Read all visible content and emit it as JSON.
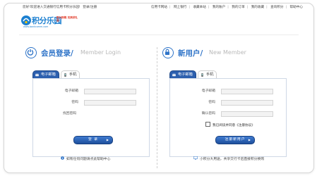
{
  "topbar": {
    "welcome": "您好!欢迎进入交通银行信用卡积分乐园!",
    "login": "登录",
    "register": "注册",
    "links": [
      "信用卡网站",
      "网上银行",
      "收藏本站",
      "我的账户",
      "我的订单",
      "我的收藏",
      "查询积分",
      "帮助中心"
    ]
  },
  "logo": {
    "name": "积分乐园",
    "tagline": "积分换购 兑换好礼品",
    "url": "www.bankcomm.com"
  },
  "login_panel": {
    "title": "会员登录/",
    "title_en": "Member Login",
    "tabs": [
      "电子邮箱",
      "手机"
    ],
    "fields": {
      "email_label": "电子邮箱",
      "password_label": "密码"
    },
    "forgot_password": "找回密码",
    "submit": "登 录",
    "help_text": "如有任何问题请点此帮助中心"
  },
  "register_panel": {
    "title": "新用户/",
    "title_en": "New Member",
    "tabs": [
      "电子邮箱",
      "手机"
    ],
    "fields": {
      "email_label": "电子邮箱",
      "password_label": "密码",
      "confirm_label": "确认密码"
    },
    "agreement": "我已阅读并同意《注册协议》",
    "submit": "注册新用户",
    "footer_text": "小积分大用途，共享交行卡后直接积分换购"
  },
  "colors": {
    "accent": "#2f74c8",
    "tab_active": "#2c5fae",
    "logo_red": "#e0301e"
  },
  "icons": {
    "login": "power-icon",
    "register": "lock-icon",
    "email_tab": "envelope-icon",
    "mobile_tab": "phone-icon",
    "help": "info-icon",
    "monitor": "monitor-icon"
  }
}
